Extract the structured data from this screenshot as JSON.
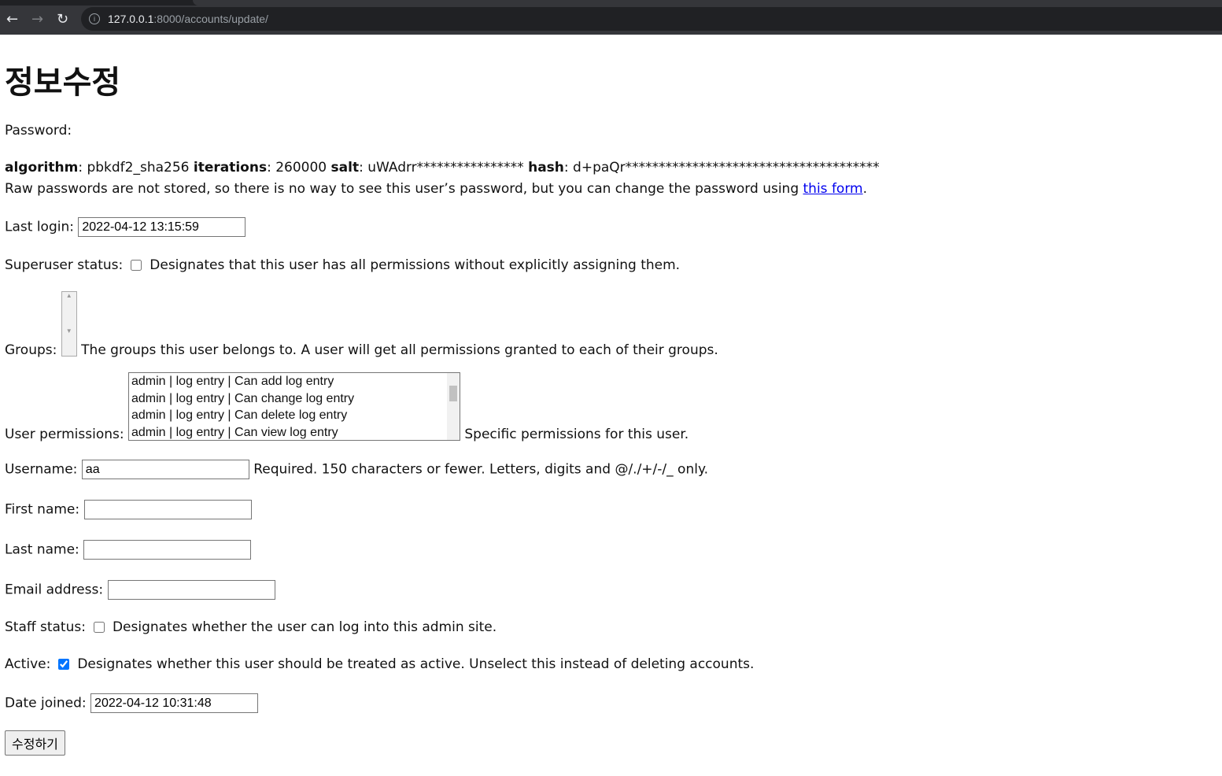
{
  "browser": {
    "url_host": "127.0.0.1",
    "url_rest": ":8000/accounts/update/"
  },
  "title": "정보수정",
  "password": {
    "label": "Password:",
    "algorithm_label": "algorithm",
    "algorithm": "pbkdf2_sha256",
    "iterations_label": "iterations",
    "iterations": "260000",
    "salt_label": "salt",
    "salt": "uWAdrr****************",
    "hash_label": "hash",
    "hash": "d+paQr**************************************",
    "help": "Raw passwords are not stored, so there is no way to see this user’s password, but you can change the password using ",
    "link": "this form"
  },
  "last_login": {
    "label": "Last login:",
    "value": "2022-04-12 13:15:59"
  },
  "superuser": {
    "label": "Superuser status:",
    "checked": false,
    "help": "Designates that this user has all permissions without explicitly assigning them."
  },
  "groups": {
    "label": "Groups:",
    "help": "The groups this user belongs to. A user will get all permissions granted to each of their groups."
  },
  "permissions": {
    "label": "User permissions:",
    "options": [
      "admin | log entry | Can add log entry",
      "admin | log entry | Can change log entry",
      "admin | log entry | Can delete log entry",
      "admin | log entry | Can view log entry"
    ],
    "help": "Specific permissions for this user."
  },
  "username": {
    "label": "Username:",
    "value": "aa",
    "help": "Required. 150 characters or fewer. Letters, digits and @/./+/-/_ only."
  },
  "first_name": {
    "label": "First name:",
    "value": ""
  },
  "last_name": {
    "label": "Last name:",
    "value": ""
  },
  "email": {
    "label": "Email address:",
    "value": ""
  },
  "staff": {
    "label": "Staff status:",
    "checked": false,
    "help": "Designates whether the user can log into this admin site."
  },
  "active": {
    "label": "Active:",
    "checked": true,
    "help": "Designates whether this user should be treated as active. Unselect this instead of deleting accounts."
  },
  "date_joined": {
    "label": "Date joined:",
    "value": "2022-04-12 10:31:48"
  },
  "submit": "수정하기"
}
